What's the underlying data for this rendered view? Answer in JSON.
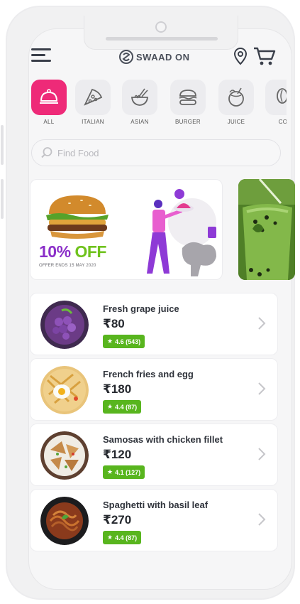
{
  "header": {
    "brand": "SWAAD ON"
  },
  "categories": [
    {
      "label": "ALL",
      "icon": "food-cloche-icon",
      "active": true
    },
    {
      "label": "ITALIAN",
      "icon": "pizza-icon",
      "active": false
    },
    {
      "label": "ASIAN",
      "icon": "noodle-bowl-icon",
      "active": false
    },
    {
      "label": "BURGER",
      "icon": "burger-icon",
      "active": false
    },
    {
      "label": "JUICE",
      "icon": "coconut-drink-icon",
      "active": false
    },
    {
      "label": "CO",
      "icon": "coffee-icon",
      "active": false
    }
  ],
  "search": {
    "placeholder": "Find Food"
  },
  "banner": {
    "offer_pct": "10%",
    "offer_word": "OFF",
    "offer_note": "OFFER ENDS 15 MAY 2020"
  },
  "items": [
    {
      "name": "Fresh grape juice",
      "price": "₹80",
      "rating": "4.6 (543)",
      "image": "grape-juice-image"
    },
    {
      "name": "French fries and egg",
      "price": "₹180",
      "rating": "4.4 (87)",
      "image": "fries-egg-image"
    },
    {
      "name": "Samosas with chicken fillet",
      "price": "₹120",
      "rating": "4.1 (127)",
      "image": "samosa-image"
    },
    {
      "name": "Spaghetti with basil leaf",
      "price": "₹270",
      "rating": "4.4 (87)",
      "image": "spaghetti-image"
    }
  ],
  "colors": {
    "accent_pink": "#ee2a78",
    "rating_green": "#58b51e",
    "offer_purple": "#8b2fc9",
    "offer_green": "#6fc21d"
  }
}
